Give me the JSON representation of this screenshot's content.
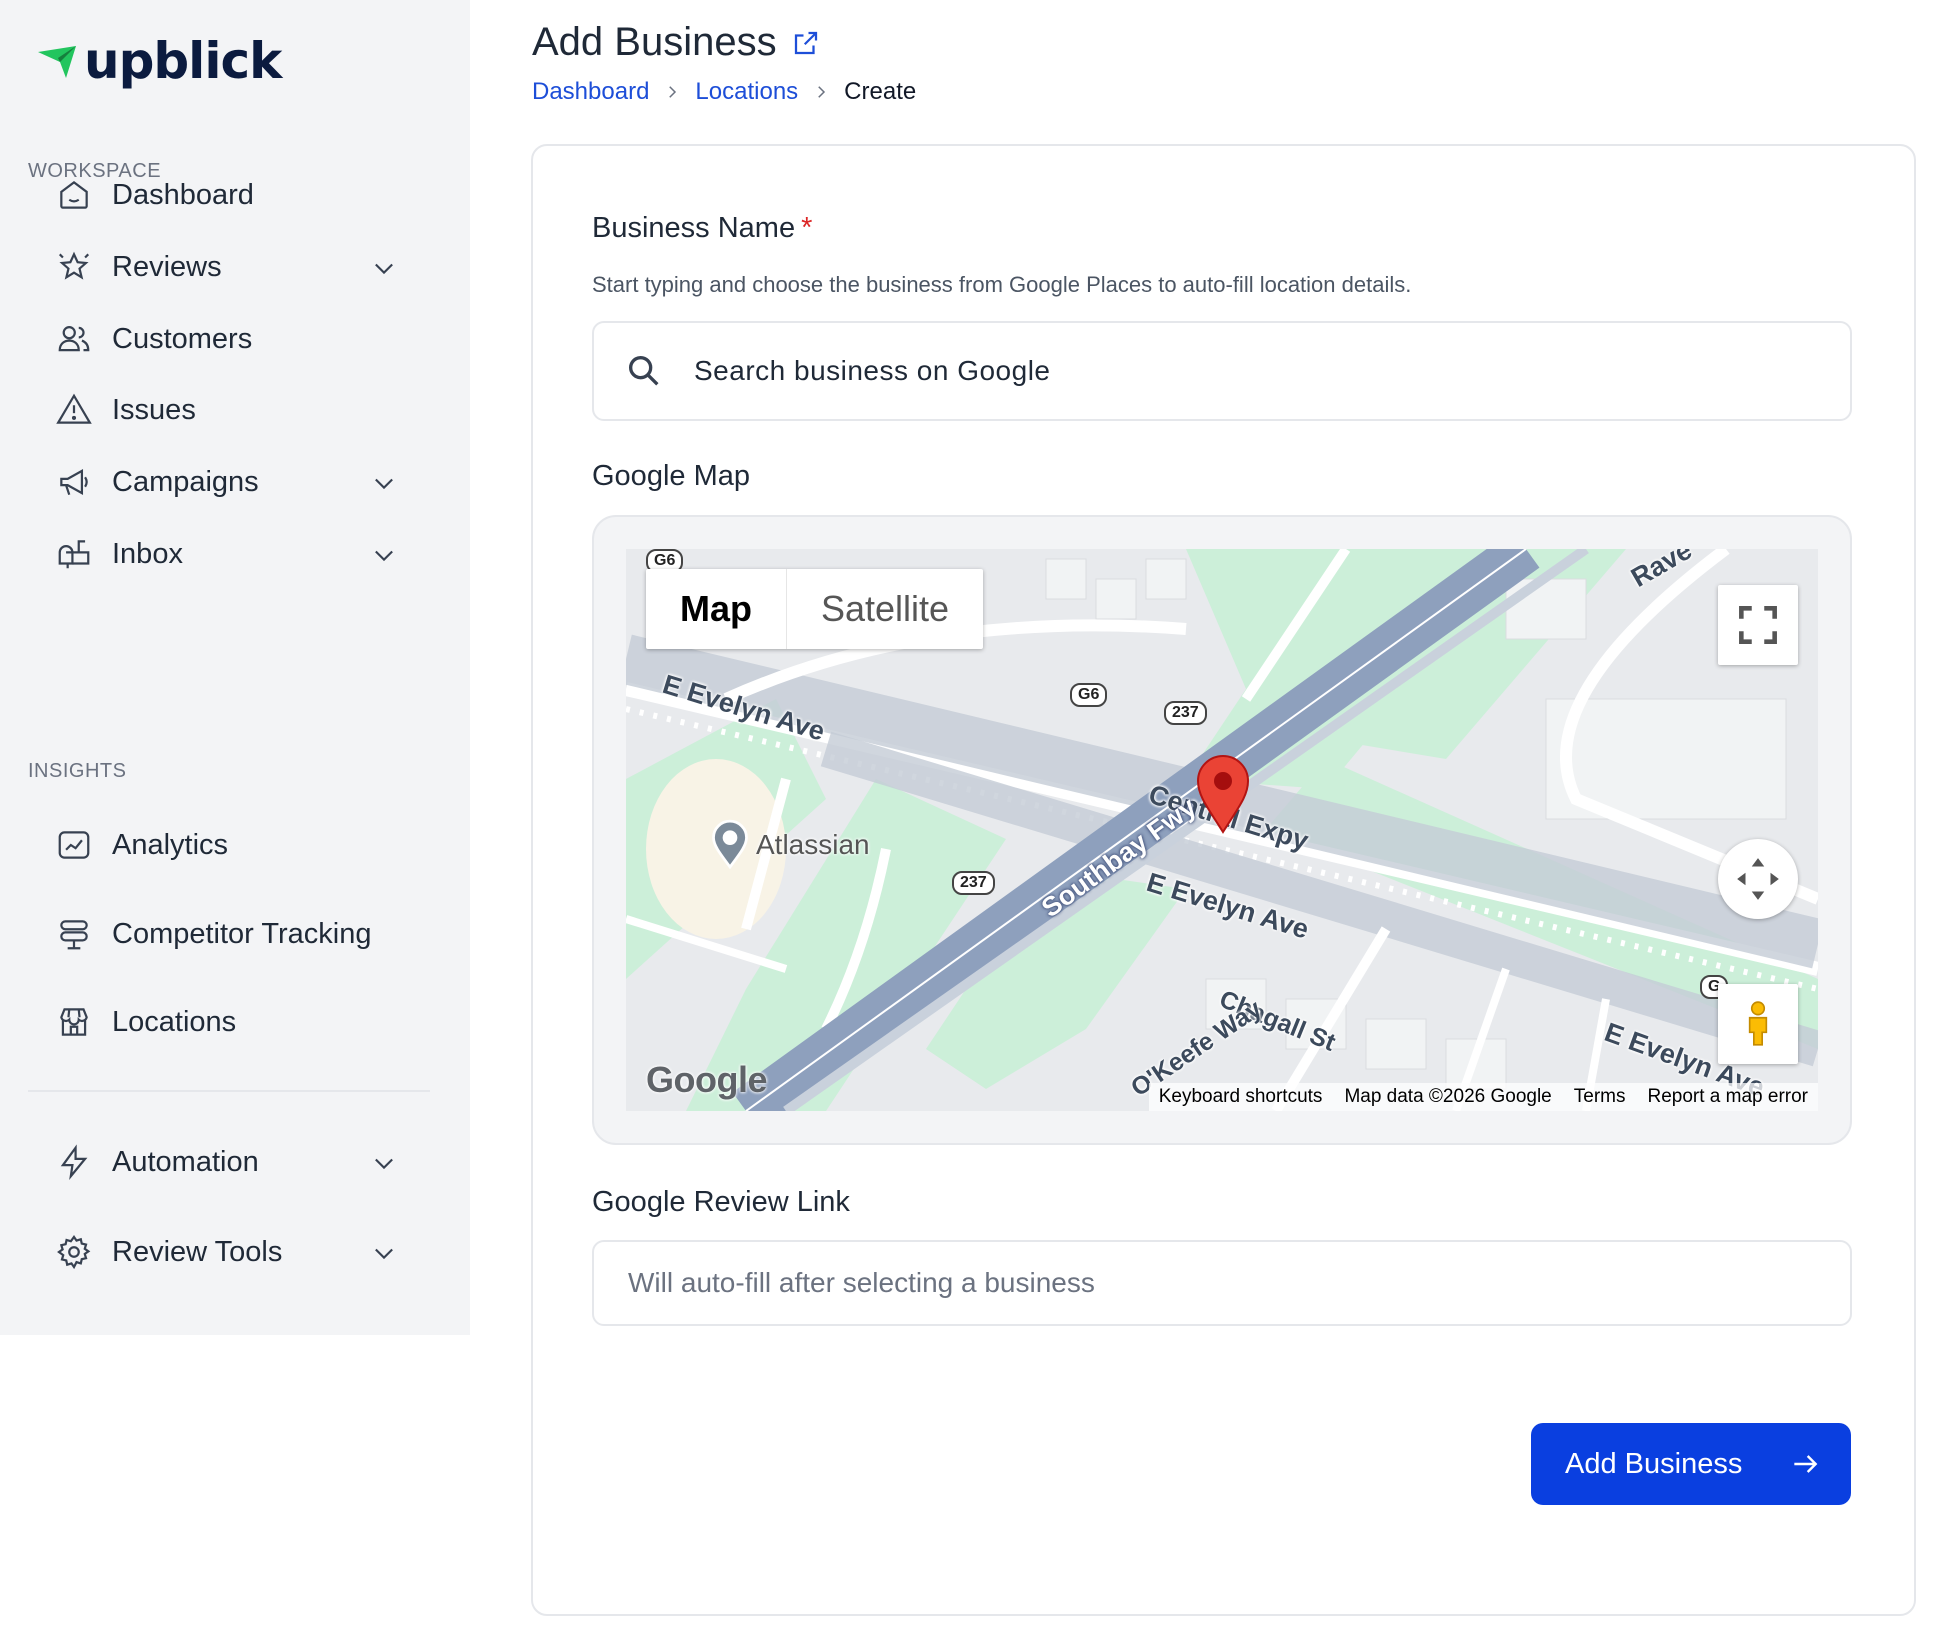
{
  "brand": {
    "name": "upblick",
    "accent": "#22c55e"
  },
  "sidebar": {
    "sections": [
      {
        "label": "WORKSPACE"
      },
      {
        "label": "INSIGHTS"
      }
    ],
    "items": [
      {
        "label": "Dashboard",
        "icon": "home-icon",
        "has_chevron": false
      },
      {
        "label": "Reviews",
        "icon": "star-icon",
        "has_chevron": true
      },
      {
        "label": "Customers",
        "icon": "users-icon",
        "has_chevron": false
      },
      {
        "label": "Issues",
        "icon": "warning-icon",
        "has_chevron": false
      },
      {
        "label": "Campaigns",
        "icon": "megaphone-icon",
        "has_chevron": true
      },
      {
        "label": "Inbox",
        "icon": "mailbox-icon",
        "has_chevron": true
      },
      {
        "label": "Analytics",
        "icon": "chart-icon",
        "has_chevron": false
      },
      {
        "label": "Competitor Tracking",
        "icon": "tracking-icon",
        "has_chevron": false
      },
      {
        "label": "Locations",
        "icon": "store-icon",
        "has_chevron": false
      },
      {
        "label": "Automation",
        "icon": "bolt-icon",
        "has_chevron": true
      },
      {
        "label": "Review Tools",
        "icon": "gear-icon",
        "has_chevron": true
      }
    ]
  },
  "header": {
    "title": "Add Business",
    "breadcrumb": [
      "Dashboard",
      "Locations",
      "Create"
    ]
  },
  "form": {
    "business_name_label": "Business Name",
    "required_mark": "*",
    "business_name_help": "Start typing and choose the business from Google Places to auto-fill location details.",
    "search_placeholder": "Search business on Google",
    "map_label": "Google Map",
    "review_link_label": "Google Review Link",
    "review_link_placeholder": "Will auto-fill after selecting a business",
    "submit_label": "Add Business",
    "submit_color": "#0a3fe0"
  },
  "map": {
    "type_options": [
      "Map",
      "Satellite"
    ],
    "selected_type": "Map",
    "logo": "Google",
    "attribution": [
      "Keyboard shortcuts",
      "Map data ©2026 Google",
      "Terms",
      "Report a map error"
    ],
    "poi": "Atlassian",
    "streets": [
      "E Evelyn Ave",
      "Central Expy",
      "Southbay Fwy",
      "E Evelyn Ave",
      "Chagall St",
      "O'Keefe Way",
      "E Evelyn Ave",
      "Rave"
    ],
    "shields": [
      "G6",
      "G6",
      "237",
      "237",
      "G"
    ]
  }
}
